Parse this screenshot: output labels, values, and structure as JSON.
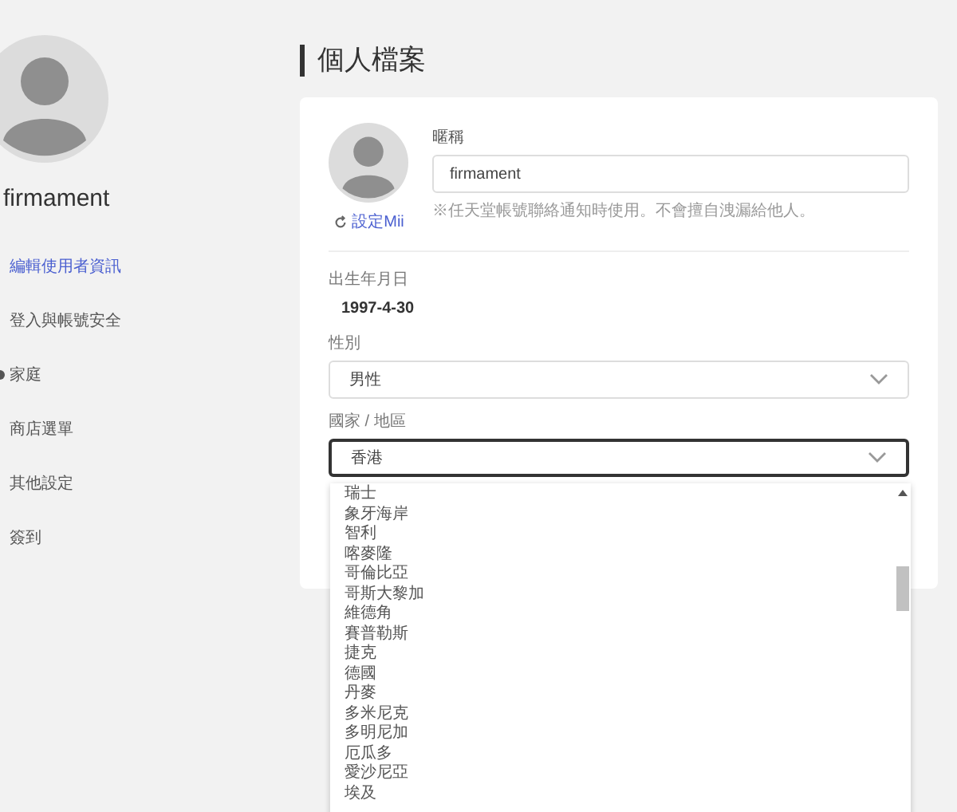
{
  "sidebar": {
    "username": "firmament",
    "items": [
      {
        "label": "編輯使用者資訊",
        "selected": true,
        "bullet": false
      },
      {
        "label": "登入與帳號安全",
        "selected": false,
        "bullet": false
      },
      {
        "label": "家庭",
        "selected": false,
        "bullet": true
      },
      {
        "label": "商店選單",
        "selected": false,
        "bullet": false
      },
      {
        "label": "其他設定",
        "selected": false,
        "bullet": false
      },
      {
        "label": "簽到",
        "selected": false,
        "bullet": false
      }
    ]
  },
  "page_title": "個人檔案",
  "profile": {
    "mii_link": "設定Mii",
    "nickname_label": "暱稱",
    "nickname_value": "firmament",
    "nickname_hint": "※任天堂帳號聯絡通知時使用。不會擅自洩漏給他人。",
    "birthday_label": "出生年月日",
    "birthday_value": "1997-4-30",
    "gender_label": "性別",
    "gender_value": "男性",
    "region_label": "國家 / 地區",
    "region_value": "香港",
    "region_expanded": true
  },
  "region_options": [
    "瑞士",
    "象牙海岸",
    "智利",
    "喀麥隆",
    "哥倫比亞",
    "哥斯大黎加",
    "維德角",
    "賽普勒斯",
    "捷克",
    "德國",
    "丹麥",
    "多米尼克",
    "多明尼加",
    "厄瓜多",
    "愛沙尼亞",
    "埃及"
  ]
}
